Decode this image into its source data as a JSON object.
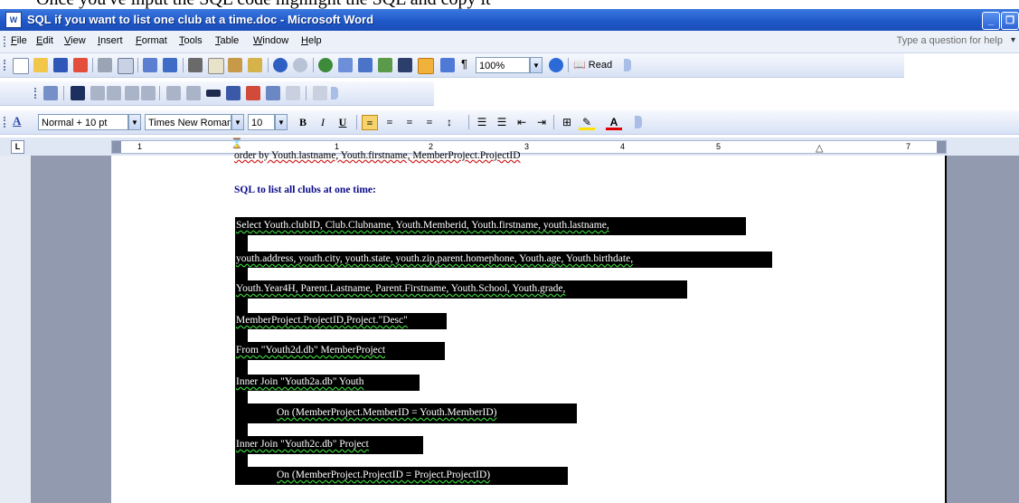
{
  "window": {
    "title": "SQL if you want to list one club at a time.doc - Microsoft Word",
    "app_icon": "W",
    "top_text_fragment": "Once you've input the SQL code highlight the SQL and copy it"
  },
  "menu": {
    "items": [
      "File",
      "Edit",
      "View",
      "Insert",
      "Format",
      "Tools",
      "Table",
      "Window",
      "Help"
    ],
    "help_placeholder": "Type a question for help"
  },
  "standard_toolbar": {
    "zoom": "100%",
    "read_label": "Read"
  },
  "formatting_toolbar": {
    "style": "Normal + 10 pt",
    "font": "Times New Roman",
    "size": "10",
    "bold": "B",
    "italic": "I",
    "underline": "U"
  },
  "ruler": {
    "numbers": [
      "1",
      "1",
      "2",
      "3",
      "4",
      "5",
      "7"
    ]
  },
  "document": {
    "clipped_line": "order by Youth.lastname, Youth.firstname, MemberProject.ProjectID",
    "heading": "SQL to list all clubs at one time:",
    "sql_lines": [
      "Select Youth.clubID, Club.Clubname, Youth.Memberid, Youth.firstname, youth.lastname,",
      "youth.address, youth.city, youth.state, youth.zip,parent.homephone, Youth.age, Youth.birthdate,",
      "Youth.Year4H, Parent.Lastname, Parent.Firstname, Youth.School, Youth.grade,",
      "MemberProject.ProjectID,Project.\"Desc\"",
      "From \"Youth2d.db\" MemberProject",
      "Inner Join \"Youth2a.db\" Youth",
      "On (MemberProject.MemberID = Youth.MemberID)",
      "Inner Join \"Youth2c.db\" Project",
      "On (MemberProject.ProjectID = Project.ProjectID)"
    ]
  },
  "colors": {
    "title_bar": "#1f56c7",
    "heading": "#0a0a8a",
    "selection": "#000000"
  }
}
